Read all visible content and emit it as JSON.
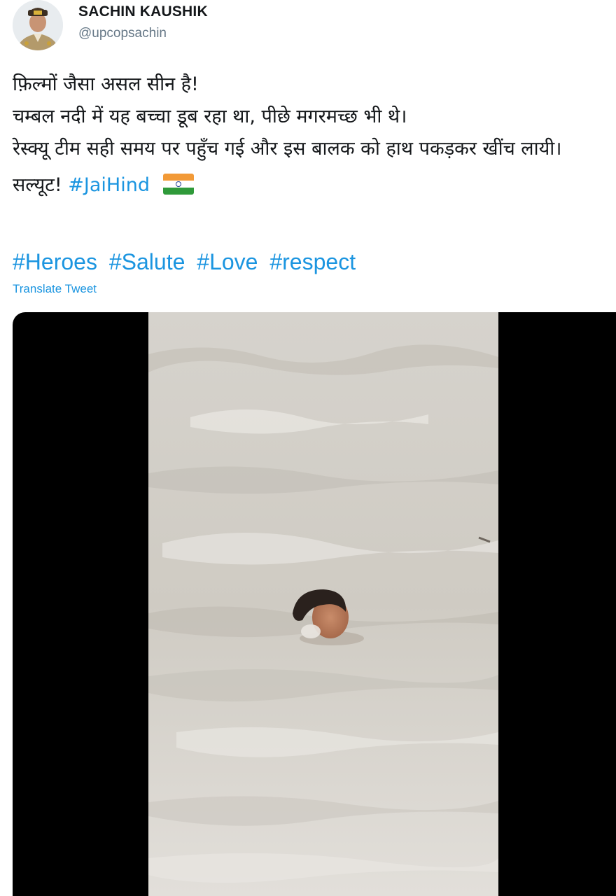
{
  "user": {
    "display_name": "SACHIN KAUSHIK",
    "handle": "@upcopsachin"
  },
  "tweet": {
    "line1": "फ़िल्मों जैसा असल सीन है!",
    "line2": "चम्बल नदी में यह बच्चा डूब रहा था, पीछे मगरमच्छ भी थे।",
    "line3": "रेस्क्यू टीम सही समय पर पहुँच गई और इस बालक को हाथ पकड़कर खींच लायी।",
    "salute_text": "सल्यूट!",
    "hashtag_jaihind": "#JaiHind",
    "flag_icon": "india-flag-icon",
    "hashtags": [
      "#Heroes",
      "#Salute",
      "#Love",
      "#respect"
    ],
    "translate_label": "Translate Tweet"
  },
  "colors": {
    "link": "#1b95e0",
    "text": "#14171a",
    "secondary": "#657786",
    "media_background": "#000000"
  }
}
